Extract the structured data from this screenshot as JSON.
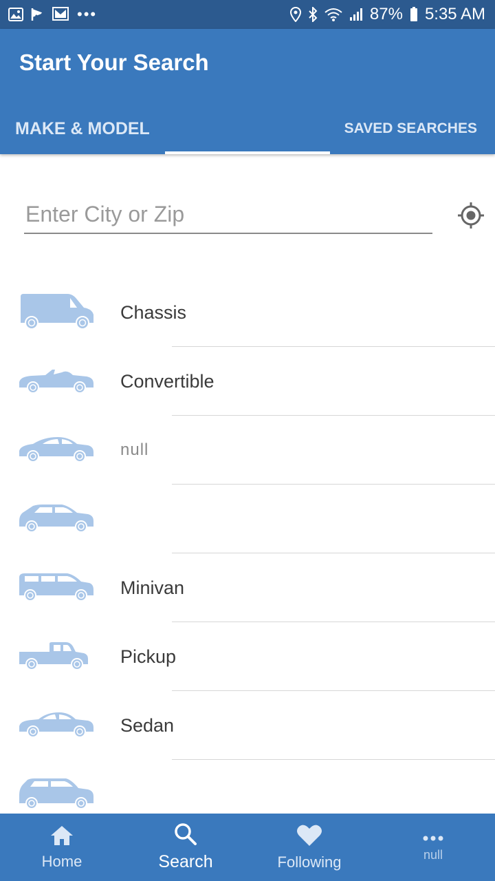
{
  "status_bar": {
    "left_icons": [
      "gallery-icon",
      "check-flag-icon",
      "mail-icon"
    ],
    "overflow": "•••",
    "battery": "87%",
    "time": "5:35 AM"
  },
  "header": {
    "title": "Start Your Search",
    "tabs": [
      {
        "label": "MAKE & MODEL",
        "active": false
      },
      {
        "label": "SAVED SEARCHES",
        "active": false
      }
    ]
  },
  "search": {
    "placeholder": "Enter City or Zip",
    "value": ""
  },
  "body_styles": [
    {
      "label": "Chassis",
      "icon": "van-icon"
    },
    {
      "label": "Convertible",
      "icon": "convertible-icon"
    },
    {
      "label": "null",
      "icon": "coupe-icon"
    },
    {
      "label": "",
      "icon": "hatchback-icon"
    },
    {
      "label": "Minivan",
      "icon": "minivan-icon"
    },
    {
      "label": "Pickup",
      "icon": "pickup-icon"
    },
    {
      "label": "Sedan",
      "icon": "sedan-icon"
    },
    {
      "label": "",
      "icon": "suv-icon"
    }
  ],
  "bottom_nav": [
    {
      "label": "Home",
      "icon": "home-icon",
      "active": false
    },
    {
      "label": "Search",
      "icon": "search-icon",
      "active": true
    },
    {
      "label": "Following",
      "icon": "heart-icon",
      "active": false
    },
    {
      "label": "null",
      "icon": "more-dots-icon",
      "active": false
    }
  ],
  "colors": {
    "primary": "#3a79bd",
    "status_bar": "#2c5a8f",
    "car_icon": "#a9c6e8"
  }
}
